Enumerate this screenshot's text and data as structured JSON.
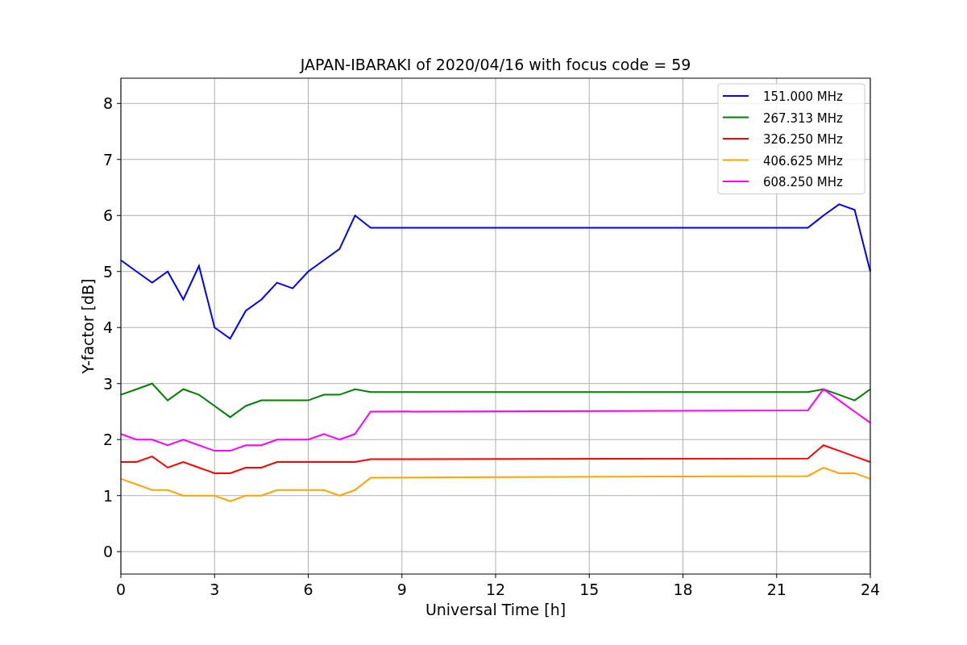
{
  "chart_data": {
    "type": "line",
    "title": "JAPAN-IBARAKI of 2020/04/16 with focus code = 59",
    "xlabel": "Universal Time [h]",
    "ylabel": "Y-factor [dB]",
    "x": [
      0,
      0.5,
      1,
      1.5,
      2,
      2.5,
      3,
      3.5,
      4,
      4.5,
      5,
      5.5,
      6,
      6.5,
      7,
      7.5,
      8,
      22,
      22.5,
      23,
      23.5,
      24
    ],
    "series": [
      {
        "name": "151.000 MHz",
        "color": "#0000ff",
        "values": [
          5.2,
          5.0,
          4.8,
          5.0,
          4.5,
          5.1,
          4.0,
          3.8,
          4.3,
          4.5,
          4.8,
          4.7,
          5.0,
          5.2,
          5.4,
          6.0,
          5.78,
          5.78,
          6.0,
          6.2,
          6.1,
          5.0
        ]
      },
      {
        "name": "267.313 MHz",
        "color": "#008000",
        "values": [
          2.8,
          2.9,
          3.0,
          2.7,
          2.9,
          2.8,
          2.6,
          2.4,
          2.6,
          2.7,
          2.7,
          2.7,
          2.7,
          2.8,
          2.8,
          2.9,
          2.85,
          2.85,
          2.9,
          2.8,
          2.7,
          2.9
        ]
      },
      {
        "name": "326.250 MHz",
        "color": "#ff0000",
        "values": [
          1.6,
          1.6,
          1.7,
          1.5,
          1.6,
          1.5,
          1.4,
          1.4,
          1.5,
          1.5,
          1.6,
          1.6,
          1.6,
          1.6,
          1.6,
          1.6,
          1.65,
          1.66,
          1.9,
          1.8,
          1.7,
          1.6
        ]
      },
      {
        "name": "406.625 MHz",
        "color": "#ffa500",
        "values": [
          1.3,
          1.2,
          1.1,
          1.1,
          1.0,
          1.0,
          1.0,
          0.9,
          1.0,
          1.0,
          1.1,
          1.1,
          1.1,
          1.1,
          1.0,
          1.1,
          1.32,
          1.35,
          1.5,
          1.4,
          1.4,
          1.3
        ]
      },
      {
        "name": "608.250 MHz",
        "color": "#ff00ff",
        "values": [
          2.1,
          2.0,
          2.0,
          1.9,
          2.0,
          1.9,
          1.8,
          1.8,
          1.9,
          1.9,
          2.0,
          2.0,
          2.0,
          2.1,
          2.0,
          2.1,
          2.5,
          2.52,
          2.9,
          2.7,
          2.5,
          2.3
        ]
      }
    ],
    "xlim": [
      0,
      24
    ],
    "ylim": [
      -0.4,
      8.45
    ],
    "xticks": [
      0,
      3,
      6,
      9,
      12,
      15,
      18,
      21,
      24
    ],
    "yticks": [
      0,
      1,
      2,
      3,
      4,
      5,
      6,
      7,
      8
    ],
    "grid": true,
    "legend": true
  }
}
